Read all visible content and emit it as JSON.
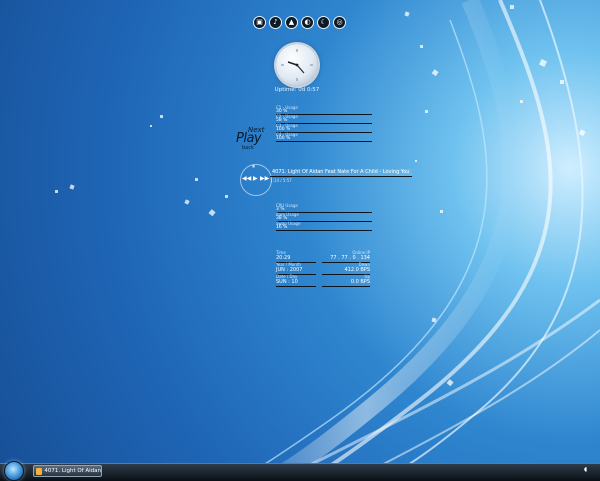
{
  "dock_icons": [
    "film-icon",
    "music-icon",
    "mountain-icon",
    "globe-icon",
    "moon-icon",
    "settings-icon"
  ],
  "dock_glyphs": [
    "▣",
    "♪",
    "▲",
    "◐",
    "☾",
    "◎"
  ],
  "clock": {
    "uptime": "Uptime: 0d 0:57"
  },
  "nowplaying_logo": {
    "top": "Next",
    "main": "Play",
    "bottom": "back"
  },
  "cpu_panel": [
    {
      "label": "C1 - Usage",
      "value": "30 %"
    },
    {
      "label": "C2 - Usage",
      "value": "58 %"
    },
    {
      "label": "C3 - Usage",
      "value": "100 %"
    },
    {
      "label": "C4 - Usage",
      "value": "100 %"
    }
  ],
  "player": {
    "title": "4071. Light Of Aidan Feat Nate For A Child - Loving You",
    "time": "1:14 / 5:57",
    "controls": [
      "⏸",
      "◀◀",
      "▶",
      "▶▶"
    ]
  },
  "system_panel": [
    {
      "label": "CPU Usage",
      "value": "3 %"
    },
    {
      "label": "Ram Usage",
      "value": "38 %"
    },
    {
      "label": "Swap Usage",
      "value": "16 %"
    }
  ],
  "info": {
    "time_label": "Time",
    "time_value": "20:29",
    "ip_label": "Online IP",
    "ip_value": "77 . 77 . 0 . 134",
    "date_label": "Year / Month",
    "date_value": "JUN : 2007",
    "in_label": "Down",
    "in_value": "412.0 BPS",
    "day_label": "Date / Day",
    "day_value": "SUN : 10",
    "out_label": "Up",
    "out_value": "0.0 BPS"
  },
  "taskbar": {
    "task_label": "4071. Light Of Aidan...",
    "tray_glyph": "◖"
  },
  "colors": {
    "wallpaper_dark": "#174f96",
    "wallpaper_light": "#cfeeff",
    "taskbar": "#0a0f15"
  }
}
